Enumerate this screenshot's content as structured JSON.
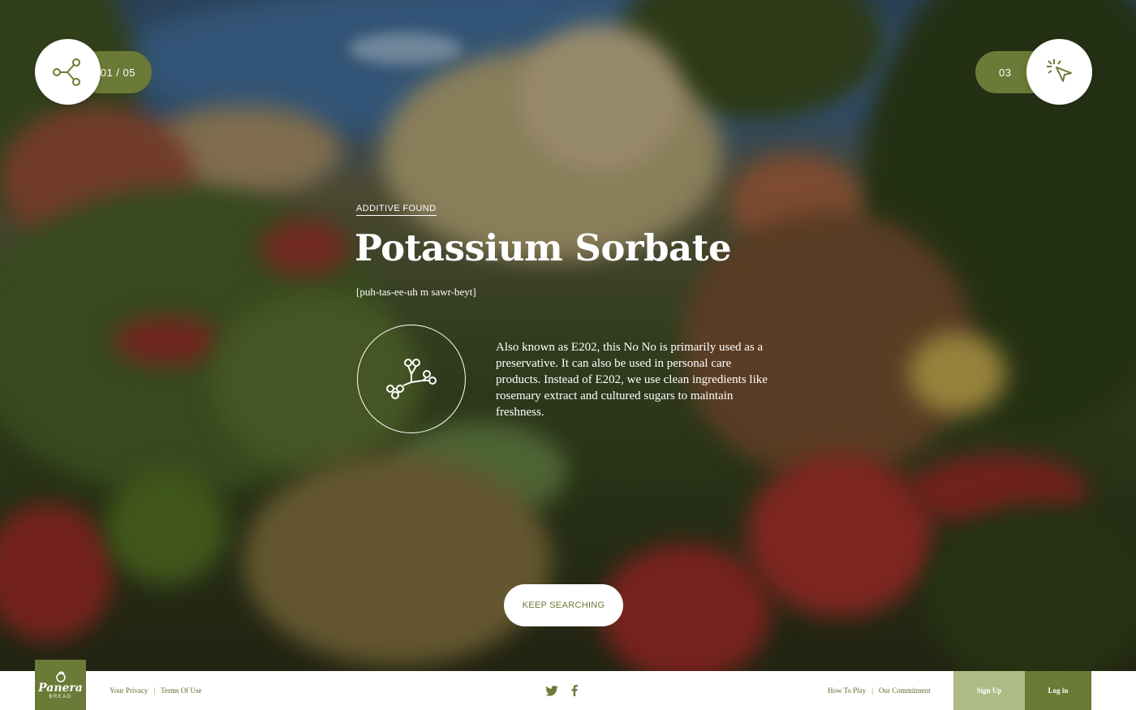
{
  "progress": {
    "counter": "01 / 05"
  },
  "hints": {
    "count": "03"
  },
  "additive": {
    "eyebrow": "Additive Found",
    "name": "Potassium Sorbate",
    "pronunciation": "[puh-tas-ee-uh m sawr-beyt]",
    "description": "Also known as E202, this No No is primarily used as a preservative. It can also be used in personal care products. Instead of E202, we use clean ingredients like rosemary extract and cultured sugars to maintain freshness."
  },
  "cta": {
    "label": "Keep Searching"
  },
  "footer": {
    "logo": {
      "word": "Panera",
      "sub": "BREAD"
    },
    "left_links": [
      "Your Privacy",
      "Terms Of Use"
    ],
    "right_links": [
      "How To Play",
      "Our Commitment"
    ],
    "social": [
      "twitter-icon",
      "facebook-icon"
    ],
    "signup_label": "Sign Up",
    "login_label": "Log in"
  },
  "colors": {
    "brand_green": "#6b7a36",
    "light_green": "#aebb86",
    "white": "#ffffff"
  },
  "icons": {
    "share": "share-icon",
    "hint": "sparkle-cursor-icon",
    "molecule": "molecule-icon"
  }
}
